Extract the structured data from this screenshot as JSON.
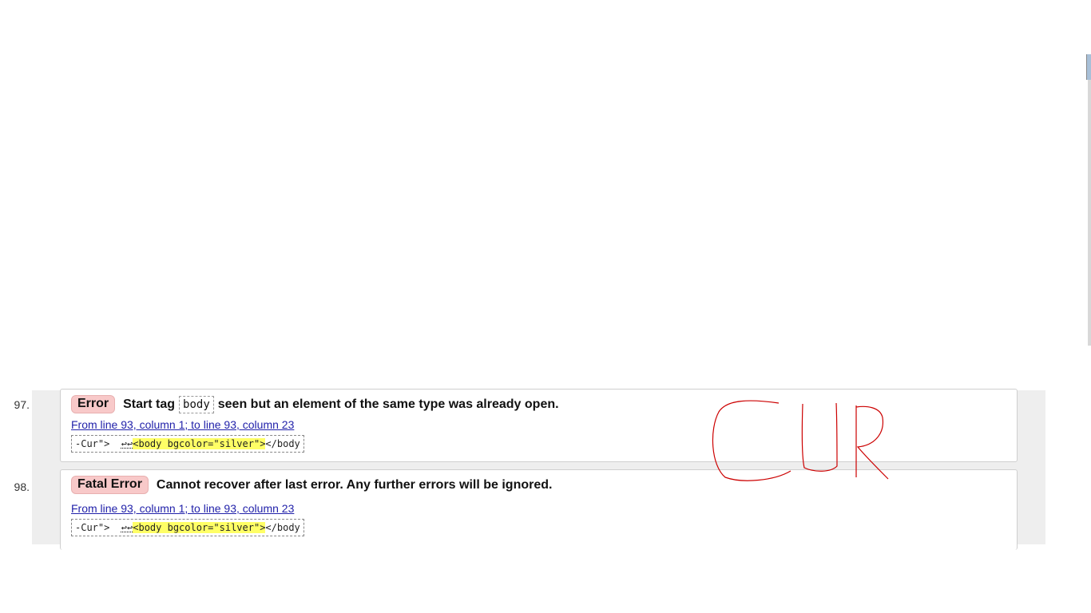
{
  "messages": [
    {
      "number": "97.",
      "type": "Error",
      "text_before": "Start tag",
      "code": "body",
      "text_after": "seen but an element of the same type was already open.",
      "location": "From line 93, column 1; to line 93, column 23",
      "extract_pre": "-Cur\">  ",
      "extract_lf": "↩↩",
      "extract_hl": "<body bgcolor=\"silver\">",
      "extract_post": "</body"
    },
    {
      "number": "98.",
      "type": "Fatal Error",
      "text": "Cannot recover after last error. Any further errors will be ignored.",
      "location": "From line 93, column 1; to line 93, column 23",
      "extract_pre": "-Cur\">  ",
      "extract_lf": "↩↩",
      "extract_hl": "<body bgcolor=\"silver\">",
      "extract_post": "</body"
    }
  ],
  "annotation": {
    "text": "CUR",
    "color": "#cc0000"
  },
  "colors": {
    "badge_bg": "#f8c9c9",
    "highlight": "#ffff66",
    "link": "#2222aa",
    "panel_bg": "#eeeeee"
  }
}
